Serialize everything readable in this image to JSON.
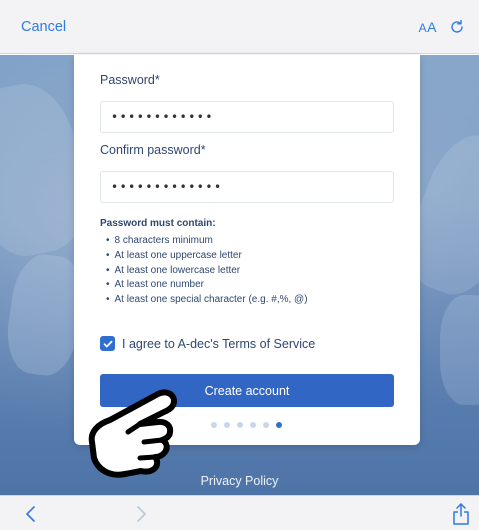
{
  "browser": {
    "cancel_label": "Cancel",
    "text_size_label_small": "A",
    "text_size_label_big": "A",
    "reload_icon": "reload-icon",
    "back_icon": "chevron-left-icon",
    "forward_icon": "chevron-right-icon",
    "share_icon": "share-icon"
  },
  "form": {
    "password_label": "Password*",
    "password_value": "••••••••••••",
    "confirm_label": "Confirm password*",
    "confirm_value": "•••••••••••••",
    "requirements_title": "Password must contain:",
    "requirements": [
      "8 characters minimum",
      "At least one uppercase letter",
      "At least one lowercase letter",
      "At least one number",
      "At least one special character (e.g. #,%, @)"
    ],
    "agree_label": "I agree to A-dec's Terms of Service",
    "agree_checked": true,
    "create_button": "Create account",
    "pager_total": 6,
    "pager_active": 6
  },
  "footer": {
    "privacy_label": "Privacy Policy"
  },
  "colors": {
    "accent": "#2f7ae5",
    "button": "#3266c4",
    "text": "#2f4770"
  }
}
